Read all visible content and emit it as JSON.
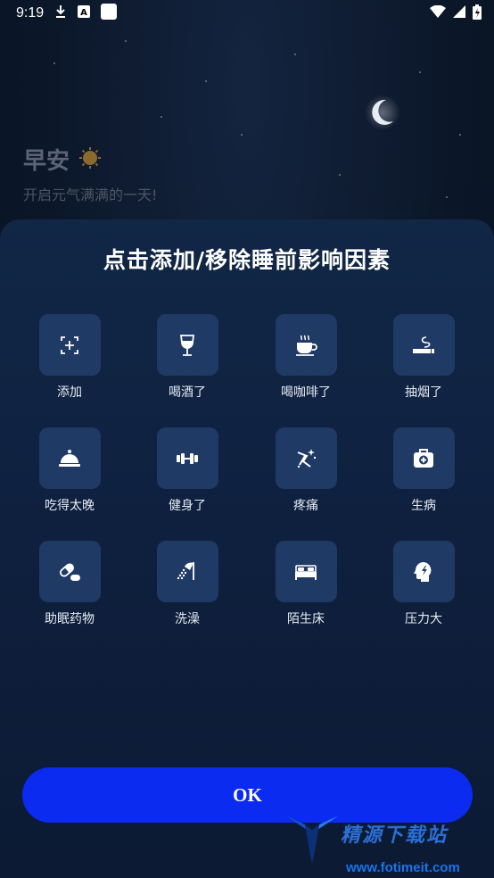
{
  "status_bar": {
    "time": "9:19",
    "icons": [
      "download-icon",
      "a-badge-icon",
      "square-icon"
    ],
    "right_icons": [
      "wifi-icon",
      "cellular-icon",
      "battery-icon"
    ]
  },
  "header": {
    "greeting": "早安",
    "greeting_icon": "sun-icon",
    "subtitle": "开启元气满满的一天!"
  },
  "sheet": {
    "title": "点击添加/移除睡前影响因素",
    "items": [
      {
        "label": "添加",
        "icon": "add-icon"
      },
      {
        "label": "喝酒了",
        "icon": "wine-glass-icon"
      },
      {
        "label": "喝咖啡了",
        "icon": "coffee-cup-icon"
      },
      {
        "label": "抽烟了",
        "icon": "cigarette-icon"
      },
      {
        "label": "吃得太晚",
        "icon": "food-cloche-icon"
      },
      {
        "label": "健身了",
        "icon": "dumbbell-icon"
      },
      {
        "label": "疼痛",
        "icon": "pain-icon"
      },
      {
        "label": "生病",
        "icon": "medical-kit-icon"
      },
      {
        "label": "助眠药物",
        "icon": "pill-icon"
      },
      {
        "label": "洗澡",
        "icon": "shower-icon"
      },
      {
        "label": "陌生床",
        "icon": "bed-icon"
      },
      {
        "label": "压力大",
        "icon": "stress-head-icon"
      }
    ],
    "ok_label": "OK"
  },
  "watermark": {
    "logo_text": "精源下载站",
    "url": "www.fotimeit.com"
  },
  "colors": {
    "accent": "#0b2bf0",
    "tile": "#1f3a64",
    "sheet": "#112746"
  }
}
